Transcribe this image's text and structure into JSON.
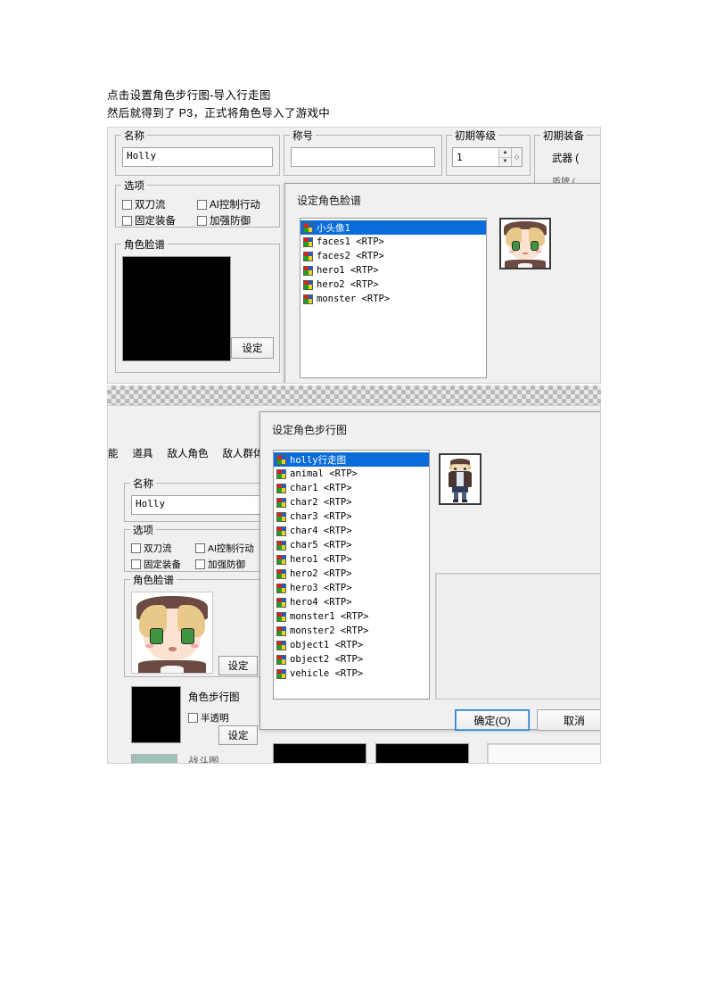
{
  "notes": {
    "line1": "点击设置角色步行图-导入行走图",
    "line2": "然后就得到了 P3，正式将角色导入了游戏中"
  },
  "screenshot1": {
    "fields": {
      "name_group": "名称",
      "name_value": "Holly",
      "title_group": "称号",
      "title_value": "",
      "level_group": "初期等级",
      "level_value": "1",
      "equip_group": "初期装备",
      "equip_weapon_label": "武器 (",
      "equip_row2_label": "盾牌 ("
    },
    "options": {
      "group": "选项",
      "items": [
        "双刀流",
        "AI控制行动",
        "固定装备",
        "加强防御"
      ]
    },
    "face_group": {
      "title": "角色脸谱",
      "set_button": "设定"
    },
    "dialog": {
      "title": "设定角色脸谱",
      "list": [
        {
          "label": "小头像1",
          "selected": true
        },
        {
          "label": "faces1 <RTP>",
          "selected": false
        },
        {
          "label": "faces2 <RTP>",
          "selected": false
        },
        {
          "label": "hero1 <RTP>",
          "selected": false
        },
        {
          "label": "hero2 <RTP>",
          "selected": false
        },
        {
          "label": "monster <RTP>",
          "selected": false
        }
      ]
    }
  },
  "screenshot2": {
    "tabs": [
      "能",
      "道具",
      "敌人角色",
      "敌人群体"
    ],
    "fields": {
      "name_group": "名称",
      "name_value": "Holly"
    },
    "options": {
      "group": "选项",
      "items": [
        "双刀流",
        "AI控制行动",
        "固定装备",
        "加强防御"
      ]
    },
    "face_group": {
      "title": "角色脸谱",
      "set_button": "设定"
    },
    "walk_group": {
      "title": "角色步行图",
      "translucent_label": "半透明",
      "set_button": "设定"
    },
    "battler_group": {
      "title": "战斗图"
    },
    "dialog": {
      "title": "设定角色步行图",
      "list": [
        {
          "label": "holly行走图",
          "selected": true
        },
        {
          "label": "animal <RTP>",
          "selected": false
        },
        {
          "label": "char1 <RTP>",
          "selected": false
        },
        {
          "label": "char2 <RTP>",
          "selected": false
        },
        {
          "label": "char3 <RTP>",
          "selected": false
        },
        {
          "label": "char4 <RTP>",
          "selected": false
        },
        {
          "label": "char5 <RTP>",
          "selected": false
        },
        {
          "label": "hero1 <RTP>",
          "selected": false
        },
        {
          "label": "hero2 <RTP>",
          "selected": false
        },
        {
          "label": "hero3 <RTP>",
          "selected": false
        },
        {
          "label": "hero4 <RTP>",
          "selected": false
        },
        {
          "label": "monster1 <RTP>",
          "selected": false
        },
        {
          "label": "monster2 <RTP>",
          "selected": false
        },
        {
          "label": "object1 <RTP>",
          "selected": false
        },
        {
          "label": "object2 <RTP>",
          "selected": false
        },
        {
          "label": "vehicle <RTP>",
          "selected": false
        }
      ],
      "ok_button": "确定(O)",
      "cancel_button": "取消"
    }
  },
  "colors": {
    "selection_blue": "#0a6cd8",
    "window_face": "#f0f0f0",
    "default_button_border": "#2a7fd4"
  }
}
